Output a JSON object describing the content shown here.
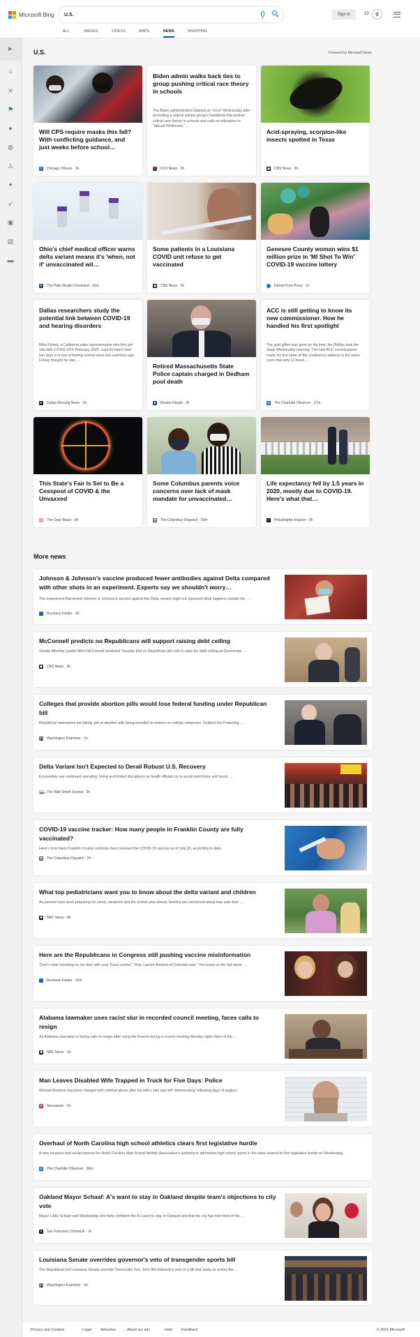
{
  "header": {
    "brand": "Microsoft Bing",
    "search_value": "U.S.",
    "signin_label": "Sign in",
    "rewards_points": "10"
  },
  "tabs": [
    {
      "label": "ALL"
    },
    {
      "label": "IMAGES"
    },
    {
      "label": "VIDEOS"
    },
    {
      "label": "MAPS"
    },
    {
      "label": "NEWS",
      "active": true
    },
    {
      "label": "SHOPPING"
    }
  ],
  "section": {
    "title": "U.S.",
    "powered_by": "Powered by Microsoft News"
  },
  "cards": [
    {
      "title": "Will CPS require masks this fall? With conflicting guidance, and just weeks before school…",
      "source": "Chicago Tribune",
      "time": "1h"
    },
    {
      "title": "Biden admin walks back ties to group pushing critical race theory in schools",
      "snippet": "The Biden administration blamed an \"error\" Wednesday after promoting a radical activist group's handbook that pushes critical race theory in schools and calls on educators to \"disrupt Whiteness.\" …",
      "source": "FOX News",
      "time": "2h"
    },
    {
      "title": "Acid-spraying, scorpion-like insects spotted in Texas",
      "source": "CBS News",
      "time": "2h"
    },
    {
      "title": "Ohio's chief medical officer warns delta variant means it's 'when, not if' unvaccinated wil…",
      "source": "The Plain Dealer Cleveland",
      "time": "31m"
    },
    {
      "title": "Some patients in a Louisiana COVID unit refuse to get vaccinated",
      "source": "CBS News",
      "time": "3h"
    },
    {
      "title": "Genesee County woman wins $1 million prize in 'MI Shot To Win' COVID-19 vaccine lottery",
      "source": "Detroit Free Press",
      "time": "1h"
    },
    {
      "title": "Dallas researchers study the potential link between COVID-19 and hearing disorders",
      "snippet": "Mike Fehely, a California sales representative who first got sick with COVID-19 in February 2020, says he hasn't had two days in a row of feeling normal since two summers ago. Fehely thought he was …",
      "source": "Dallas Morning News",
      "time": "2h"
    },
    {
      "title": "Retired Massachusetts State Police captain charged in Dedham pool death",
      "source": "Boston Herald",
      "time": "3h"
    },
    {
      "title": "ACC is still getting to know its new commissioner. How he handled his first spotlight",
      "snippet": "The gold glitter was gone by the time Jim Phillips took the stage Wednesday morning. The new ACC commissioner made his first state-of-the-conference address in the same room that only 12 hours …",
      "source": "The Charlotte Observer",
      "time": "27m"
    },
    {
      "title": "This State's Fair Is Set to Be a Cesspool of COVID & the Unvaxxed",
      "source": "The Daily Beast",
      "time": "8h"
    },
    {
      "title": "Some Columbus parents voice concerns over lack of mask mandate for unvaccinated…",
      "source": "The Columbus Dispatch",
      "time": "50m"
    },
    {
      "title": "Life expectancy fell by 1.5 years in 2020, mostly due to COVID-19. Here's what that…",
      "source": "Philadelphia Inquirer",
      "time": "8h"
    }
  ],
  "more_news": {
    "title": "More news",
    "items": [
      {
        "title": "Johnson & Johnson's vaccine produced fewer antibodies against Delta compared with other shots in an experiment. Experts say we shouldn't worry…",
        "snippet": "The experiment that tested Johnson & Johnson's vaccine against the Delta variant might not represent what happens outside the …",
        "source": "Business Insider",
        "time": "3h"
      },
      {
        "title": "McConnell predicts no Republicans will support raising debt ceiling",
        "snippet": "Senate Minority Leader Mitch McConnell predicted Tuesday that no Republican will vote to raise the debt ceiling as Democrats …",
        "source": "CBS News",
        "time": "3h"
      },
      {
        "title": "Colleges that provide abortion pills would lose federal funding under Republican bill",
        "snippet": "Republican lawmakers are taking aim at abortion pills being provided to women on college campuses. Dubbed the Protecting …",
        "source": "Washington Examiner",
        "time": "1h"
      },
      {
        "title": "Delta Variant Isn't Expected to Derail Robust U.S. Recovery",
        "snippet": "Economists see continued spending, hiring and limited disruptions as health officials try to avoid restrictions and boost …",
        "source": "The Wall Street Journal",
        "time": "3h"
      },
      {
        "title": "COVID-19 vaccine tracker: How many people in Franklin County are fully vaccinated?",
        "snippet": "Here's how many Franklin County residents have received the COVID-19 vaccine as of July 20, according to data.",
        "source": "The Columbus Dispatch",
        "time": "3h"
      },
      {
        "title": "What top pediatricians want you to know about the delta variant and children",
        "snippet": "As parents have been preparing for camp, vacations and the school year ahead, families are concerned about how safe their …",
        "source": "NBC News",
        "time": "9h"
      },
      {
        "title": "Here are the Republicans in Congress still pushing vaccine misinformation",
        "snippet": "\"Don't come knocking on my door with your 'Fauci ouchie',\" Rep. Lauren Boebert of Colorado said. \"You leave us the hell alone …",
        "source": "Business Insider",
        "time": "41m"
      },
      {
        "title": "Alabama lawmaker uses racist slur in recorded council meeting, faces calls to resign",
        "snippet": "An Alabama lawmaker is facing calls to resign after using the N-word during a council meeting Monday night.Video of the …",
        "source": "NBC News",
        "time": "1h"
      },
      {
        "title": "Man Leaves Disabled Wife Trapped in Truck for Five Days: Police",
        "snippet": "Michael Redmon has been charged with criminal abuse after his wife's skin was left \"deteriorating\" following days of neglect.",
        "source": "Newsweek",
        "time": "1h"
      },
      {
        "title": "Overhaul of North Carolina high school athletics clears first legislative hurdle",
        "snippet": "A new measure that would remove the North Carolina High School Athletic Association's authority to administer high school sports in the state cleared its first legislative hurdle on Wednesday.",
        "source": "The Charlotte Observer",
        "time": "36m"
      },
      {
        "title": "Oakland Mayor Schaaf: A's want to stay in Oakland despite team's objections to city vote",
        "snippet": "Mayor Libby Schaaf said Wednesday she feels confident the A's want to stay in Oakland and that the city has met most of the …",
        "source": "San Francisco Chronicle",
        "time": "1h"
      },
      {
        "title": "Louisiana Senate overrides governor's veto of transgender sports bill",
        "snippet": "The Republican-led Louisiana Senate override Democratic Gov. John Bel Edwards's veto of a bill that seeks to restrict the …",
        "source": "Washington Examiner",
        "time": "2h"
      }
    ]
  },
  "footer": {
    "links": [
      "Privacy and Cookies",
      "Legal",
      "Advertise",
      "About our ads",
      "Help",
      "Feedback"
    ],
    "copyright": "© 2021 Microsoft"
  }
}
